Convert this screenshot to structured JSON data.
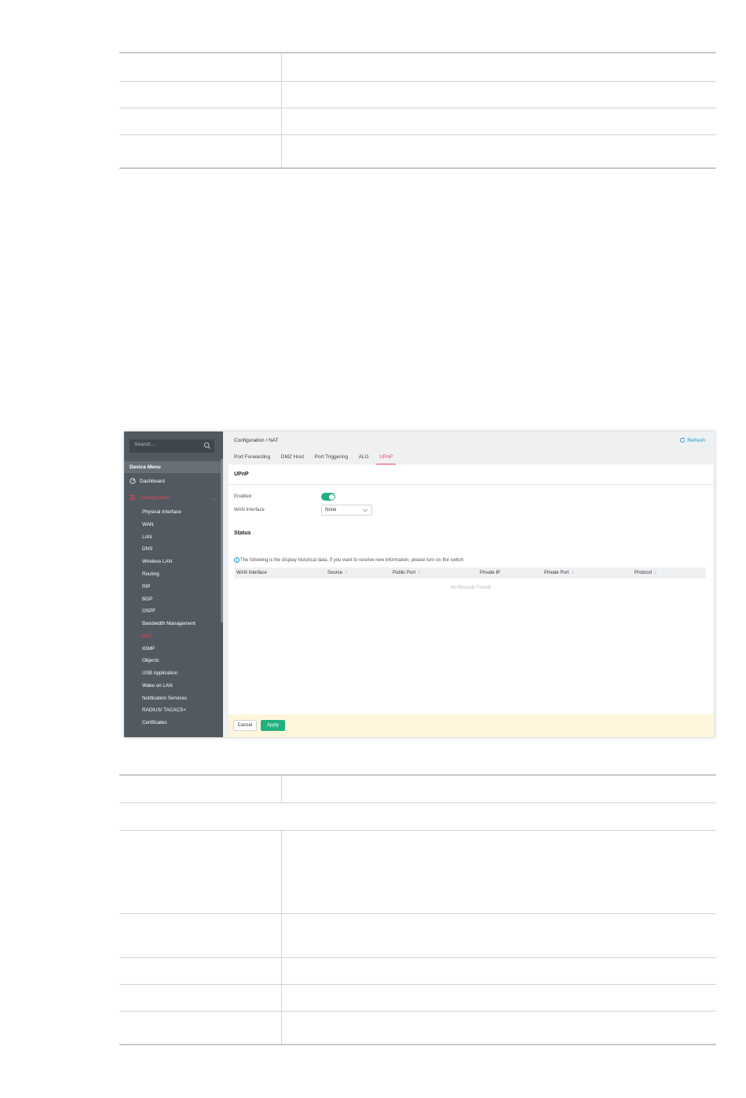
{
  "window": {
    "breadcrumb": "Configuration / NAT",
    "refresh_label": "Refresh"
  },
  "sidebar": {
    "search_placeholder": "Search...",
    "menu_header": "Device Menu",
    "dashboard": "Dashboard",
    "configuration": "Configuration",
    "items": [
      {
        "label": "Physical Interface"
      },
      {
        "label": "WAN"
      },
      {
        "label": "LAN"
      },
      {
        "label": "DNS"
      },
      {
        "label": "Wireless LAN"
      },
      {
        "label": "Routing"
      },
      {
        "label": "RIP"
      },
      {
        "label": "BGP"
      },
      {
        "label": "OSPF"
      },
      {
        "label": "Bandwidth Management"
      },
      {
        "label": "NAT",
        "active": true
      },
      {
        "label": "IGMP"
      },
      {
        "label": "Objects"
      },
      {
        "label": "USB Application"
      },
      {
        "label": "Wake on LAN"
      },
      {
        "label": "Notification Services"
      },
      {
        "label": "RADIUS/ TACACS+"
      },
      {
        "label": "Certificates"
      }
    ]
  },
  "tabs": [
    {
      "label": "Port Forwarding"
    },
    {
      "label": "DMZ Host"
    },
    {
      "label": "Port Triggering"
    },
    {
      "label": "ALG"
    },
    {
      "label": "UPnP",
      "active": true
    }
  ],
  "panel": {
    "title": "UPnP",
    "enabled_label": "Enabled",
    "enabled": true,
    "wan_label": "WAN Interface",
    "wan_value": "None",
    "status_title": "Status",
    "info_text": "The following is the display historical data, If you want to receive new information, please turn on the switch",
    "columns": [
      "WAN Interface",
      "Source",
      "Public Port",
      "Private IP",
      "Private Port",
      "Protocol"
    ],
    "empty_text": "No Records Found!",
    "cancel_label": "Cancel",
    "apply_label": "Apply"
  },
  "colors": {
    "accent_red": "#e8455a",
    "accent_green": "#22b07d",
    "link_blue": "#1f8fd1",
    "sidebar_bg": "#525a61"
  }
}
